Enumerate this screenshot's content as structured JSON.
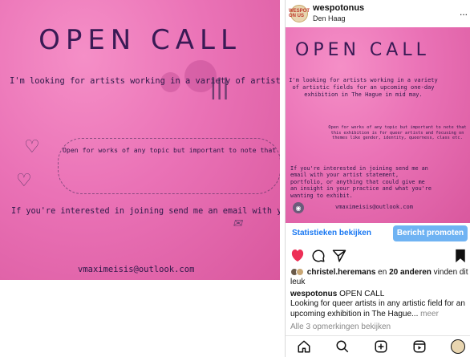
{
  "poster": {
    "title": "OPEN CALL",
    "p1": "I'm looking for artists working in a variety of artistic fields for an upcoming one-day exhibition in The Hague in mid may.",
    "p2": "Open for works of any topic but important to note that this exhibition is for queer artists and focusing on themes like gender, identity, queerness, class etc.",
    "p3": "If you're interested in joining send me an email with your artist statement, portfolio, or anything that could give me an insight in your practice and what you're wanting to exhibit.",
    "email": "vmaximeisis@outlook.com"
  },
  "post": {
    "username": "wespotonus",
    "location": "Den Haag",
    "more": "...",
    "avatar_text": "WESPOT ON US",
    "stats_label": "Statistieken bekijken",
    "promote_label": "Bericht promoten",
    "likes_user": "christel.heremans",
    "likes_mid": " en ",
    "likes_count": "20 anderen",
    "likes_suffix": " vinden dit leuk",
    "caption_user": "wespotonus",
    "caption_title": " OPEN CALL",
    "caption_text": "Looking for queer artists in any artistic field for an upcoming exhibition in The Hague...",
    "caption_more": " meer",
    "comments_label": "Alle 3 opmerkingen bekijken"
  },
  "icons": {
    "like": "heart-icon",
    "comment": "comment-icon",
    "share": "send-icon",
    "save": "bookmark-icon"
  },
  "colors": {
    "accent": "#1877f2",
    "like": "#ed2f56",
    "poster_pink": "#ea72b6"
  }
}
